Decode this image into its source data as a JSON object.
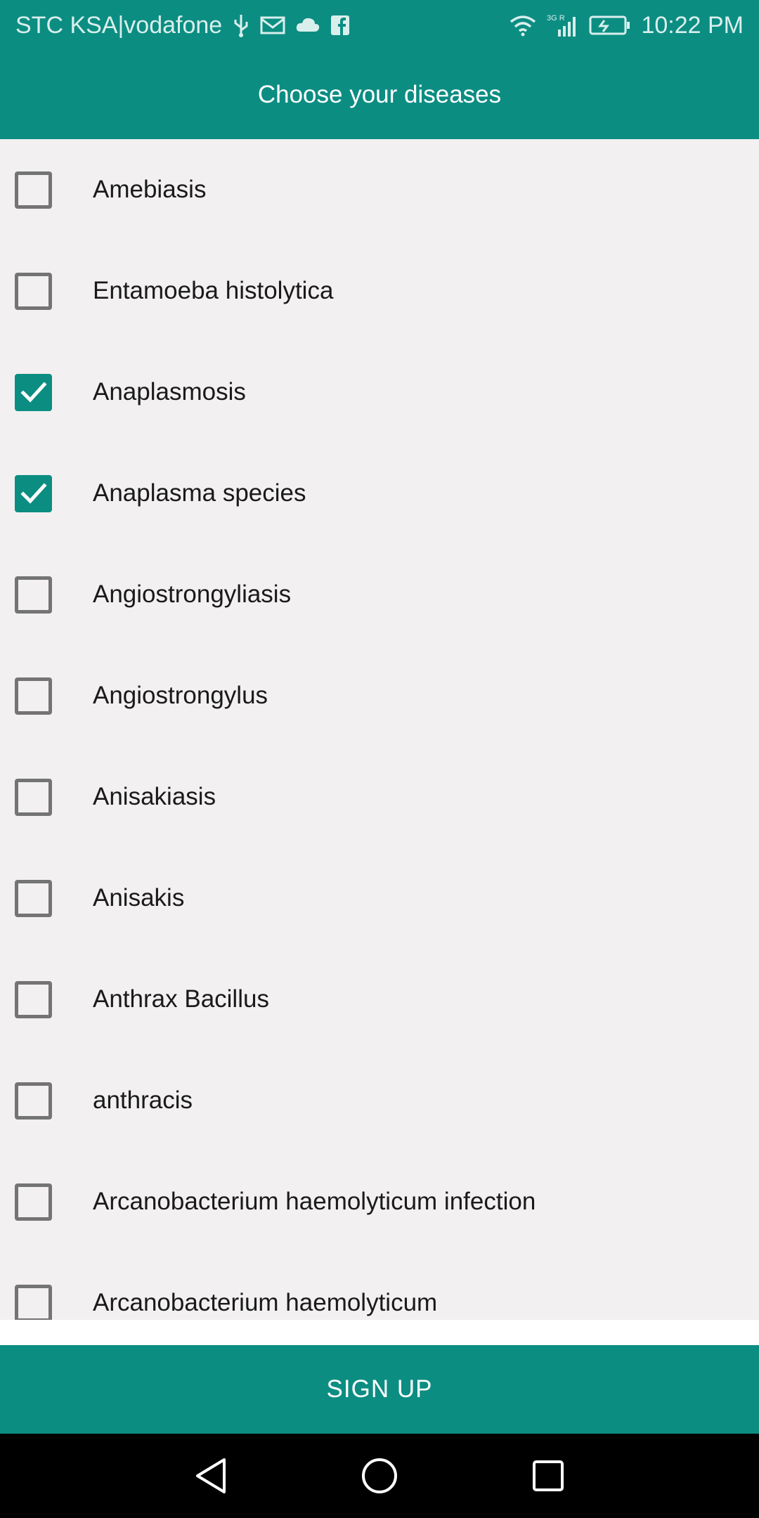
{
  "status_bar": {
    "carrier": "STC KSA|vodafone",
    "network": "3G R",
    "time": "10:22 PM",
    "icons_left": [
      "usb-icon",
      "mail-icon",
      "cloud-icon",
      "facebook-icon"
    ],
    "icons_right": [
      "wifi-icon",
      "signal-icon",
      "battery-charging-icon"
    ]
  },
  "app_bar": {
    "title": "Choose your diseases"
  },
  "diseases": [
    {
      "label": "Amebiasis",
      "checked": false
    },
    {
      "label": "Entamoeba histolytica",
      "checked": false
    },
    {
      "label": "Anaplasmosis",
      "checked": true
    },
    {
      "label": "Anaplasma species",
      "checked": true
    },
    {
      "label": "Angiostrongyliasis",
      "checked": false
    },
    {
      "label": "Angiostrongylus",
      "checked": false
    },
    {
      "label": "Anisakiasis",
      "checked": false
    },
    {
      "label": "Anisakis",
      "checked": false
    },
    {
      "label": "Anthrax Bacillus",
      "checked": false
    },
    {
      "label": "anthracis",
      "checked": false
    },
    {
      "label": "Arcanobacterium haemolyticum infection",
      "checked": false
    },
    {
      "label": "Arcanobacterium haemolyticum",
      "checked": false
    }
  ],
  "signup_button": {
    "label": "SIGN UP"
  },
  "nav_bar": {
    "icons": [
      "back-icon",
      "home-icon",
      "recents-icon"
    ]
  },
  "colors": {
    "primary": "#0c8d82",
    "background": "#f2f0f1",
    "checkbox_border": "#747474"
  }
}
